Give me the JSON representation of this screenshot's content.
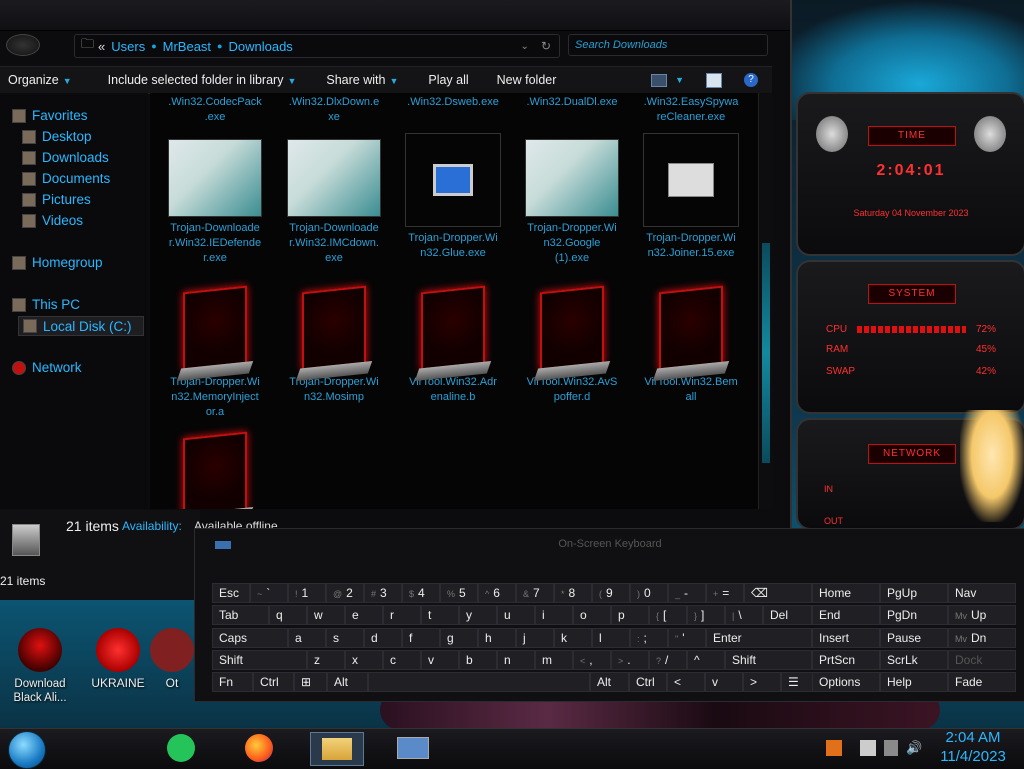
{
  "explorer": {
    "address": {
      "back_glyph": "«",
      "crumbs": [
        "Users",
        "MrBeast",
        "Downloads"
      ]
    },
    "search_placeholder": "Search Downloads",
    "toolbar": [
      "Organize",
      "Include selected folder in library",
      "Share with",
      "Play all",
      "New folder"
    ],
    "nav": {
      "favorites": "Favorites",
      "desktop": "Desktop",
      "downloads": "Downloads",
      "documents": "Documents",
      "pictures": "Pictures",
      "videos": "Videos",
      "homegroup": "Homegroup",
      "thispc": "This PC",
      "localdisk": "Local Disk (C:)",
      "network": "Network"
    },
    "files_top": [
      ".Win32.CodecPack\n.exe",
      ".Win32.DlxDown.e\nxe",
      ".Win32.Dsweb.exe",
      ".Win32.DualDl.exe",
      ".Win32.EasySpywa\nreCleaner.exe"
    ],
    "files_row2": [
      "Trojan-Downloade\nr.Win32.IEDefende\nr.exe",
      "Trojan-Downloade\nr.Win32.IMCdown.\nexe",
      "Trojan-Dropper.Wi\nn32.Glue.exe",
      "Trojan-Dropper.Wi\nn32.Google\n(1).exe",
      "Trojan-Dropper.Wi\nn32.Joiner.15.exe"
    ],
    "files_row3": [
      "Trojan-Dropper.Wi\nn32.MemoryInject\nor.a",
      "Trojan-Dropper.Wi\nn32.Mosimp",
      "VirTool.Win32.Adr\nenaline.b",
      "VirTool.Win32.AvS\npoffer.d",
      "VirTool.Win32.Bem\nall"
    ],
    "status": {
      "count": "21 items",
      "availability_label": "Availability:",
      "availability_value": "Available offline",
      "count_small": "21 items"
    }
  },
  "gadgets": {
    "time": {
      "title": "TIME",
      "clock": "2:04:01",
      "date": "Saturday 04 November 2023"
    },
    "system": {
      "title": "SYSTEM",
      "cpu_label": "CPU",
      "cpu": "72%",
      "ram_label": "RAM",
      "ram": "45%",
      "swap_label": "SWAP",
      "swap": "42%"
    },
    "network": {
      "title": "NETWORK",
      "in_label": "IN",
      "out_label": "OUT"
    }
  },
  "osk": {
    "title": "On-Screen Keyboard",
    "row1": [
      "Esc",
      "~ `",
      "! 1",
      "@ 2",
      "# 3",
      "$ 4",
      "% 5",
      "^ 6",
      "& 7",
      "* 8",
      "( 9",
      ") 0",
      "_ -",
      "+ =",
      "⌫"
    ],
    "row2": [
      "Tab",
      "q",
      "w",
      "e",
      "r",
      "t",
      "y",
      "u",
      "i",
      "o",
      "p",
      "{ [",
      "} ]",
      "| \\",
      "Del"
    ],
    "row3": [
      "Caps",
      "a",
      "s",
      "d",
      "f",
      "g",
      "h",
      "j",
      "k",
      "l",
      ": ;",
      "\" '",
      "Enter"
    ],
    "row4": [
      "Shift",
      "z",
      "x",
      "c",
      "v",
      "b",
      "n",
      "m",
      "< ,",
      "> .",
      "? /",
      "^",
      "Shift"
    ],
    "row5": [
      "Fn",
      "Ctrl",
      "⊞",
      "Alt",
      "",
      "Alt",
      "Ctrl",
      "<",
      "v",
      ">",
      "☰"
    ],
    "nav": [
      [
        "Home",
        "PgUp",
        "Nav"
      ],
      [
        "End",
        "PgDn",
        "Mv Up"
      ],
      [
        "Insert",
        "Pause",
        "Mv Dn"
      ],
      [
        "PrtScn",
        "ScrLk",
        "Dock"
      ],
      [
        "Options",
        "Help",
        "Fade"
      ]
    ]
  },
  "desktop_icons": [
    "Download\nBlack Ali...",
    "UKRAINE",
    "Ot"
  ],
  "clock": {
    "time": "2:04 AM",
    "date": "11/4/2023"
  },
  "colors": {
    "accent": "#29b8ff",
    "alert": "#ff3030"
  }
}
